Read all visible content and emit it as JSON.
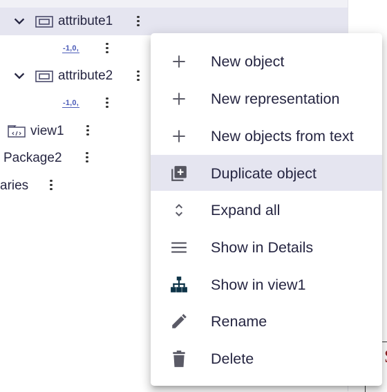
{
  "tree": {
    "rows": [
      {
        "label": "attribute1",
        "kind": "attribute",
        "expanded": true,
        "selected": true
      },
      {
        "label": "-1,0,",
        "kind": "number-literal"
      },
      {
        "label": "attribute2",
        "kind": "attribute",
        "expanded": true
      },
      {
        "label": "-1,0,",
        "kind": "number-literal"
      },
      {
        "label": "view1",
        "kind": "view"
      },
      {
        "label": "Package2",
        "kind": "package"
      },
      {
        "label": "aries",
        "kind": "truncated-item"
      }
    ]
  },
  "context_menu": {
    "items": [
      {
        "label": "New object",
        "icon": "plus-icon"
      },
      {
        "label": "New representation",
        "icon": "plus-icon"
      },
      {
        "label": "New objects from text",
        "icon": "plus-icon"
      },
      {
        "label": "Duplicate object",
        "icon": "library-add-icon",
        "highlighted": true
      },
      {
        "label": "Expand all",
        "icon": "unfold-more-icon"
      },
      {
        "label": "Show in Details",
        "icon": "menu-lines-icon"
      },
      {
        "label": "Show in view1",
        "icon": "account-tree-icon"
      },
      {
        "label": "Rename",
        "icon": "pencil-icon"
      },
      {
        "label": "Delete",
        "icon": "trash-icon"
      }
    ]
  },
  "colors": {
    "selected_row": "#e5e5f0",
    "text": "#262642",
    "accent_icon": "#4b5bb8",
    "tree_icon_dark": "#0d3347"
  }
}
